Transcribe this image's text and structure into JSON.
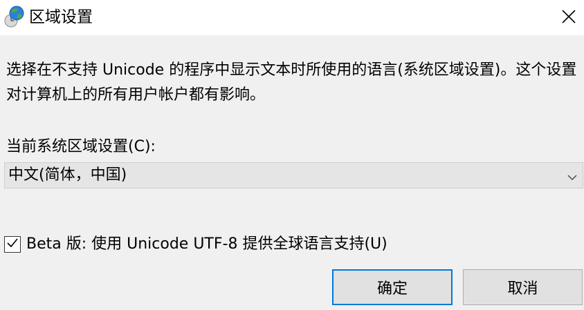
{
  "window": {
    "title": "区域设置",
    "icon": "globe-clock-icon",
    "close_icon": "close-icon"
  },
  "description": "选择在不支持 Unicode 的程序中显示文本时所使用的语言(系统区域设置)。这个设置对计算机上的所有用户帐户都有影响。",
  "locale": {
    "label": "当前系统区域设置(C):",
    "selected": "中文(简体，中国)",
    "dropdown_icon": "chevron-down-icon"
  },
  "beta_utf8": {
    "label": "Beta 版: 使用 Unicode UTF-8 提供全球语言支持(U)",
    "checked": true
  },
  "buttons": {
    "ok": "确定",
    "cancel": "取消"
  },
  "colors": {
    "accent": "#0078d7",
    "background": "#f0f0f0",
    "titlebar": "#ffffff"
  }
}
